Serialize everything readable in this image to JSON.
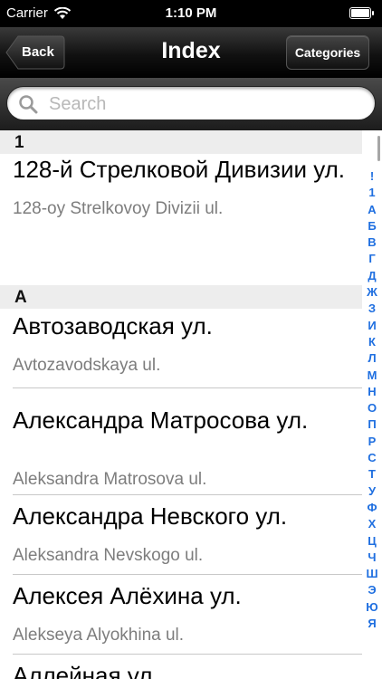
{
  "status": {
    "carrier": "Carrier",
    "time": "1:10 PM",
    "battery_level": 1.0
  },
  "nav": {
    "back_label": "Back",
    "title": "Index",
    "categories_label": "Categories"
  },
  "search": {
    "placeholder": "Search",
    "value": ""
  },
  "sections": [
    {
      "header": "1",
      "rows": [
        {
          "title": "128-й Стрелковой Дивизии ул.",
          "subtitle": "128-oy Strelkovoy Divizii ul."
        }
      ]
    },
    {
      "header": "А",
      "rows": [
        {
          "title": "Автозаводская ул.",
          "subtitle": "Avtozavodskaya ul."
        },
        {
          "title": "Александра Матросова ул.",
          "subtitle": "Aleksandra Matrosova ul."
        },
        {
          "title": "Александра Невского ул.",
          "subtitle": "Aleksandra Nevskogo ul."
        },
        {
          "title": "Алексея Алёхина ул.",
          "subtitle": "Alekseya Alyokhina ul."
        },
        {
          "title": "Аллейная ул.",
          "subtitle": ""
        }
      ]
    }
  ],
  "index_letters": [
    "!",
    "1",
    "А",
    "Б",
    "В",
    "Г",
    "Д",
    "Ж",
    "З",
    "И",
    "К",
    "Л",
    "М",
    "Н",
    "О",
    "П",
    "Р",
    "С",
    "Т",
    "У",
    "Ф",
    "Х",
    "Ц",
    "Ч",
    "Ш",
    "Э",
    "Ю",
    "Я"
  ],
  "colors": {
    "index_accent": "#1f6fe0",
    "nav_background": "#111111",
    "section_header_background": "#ededed"
  },
  "icons": {
    "search": "search-icon",
    "wifi": "wifi-icon",
    "battery": "battery-icon",
    "back_chevron": "back-arrow-icon"
  }
}
